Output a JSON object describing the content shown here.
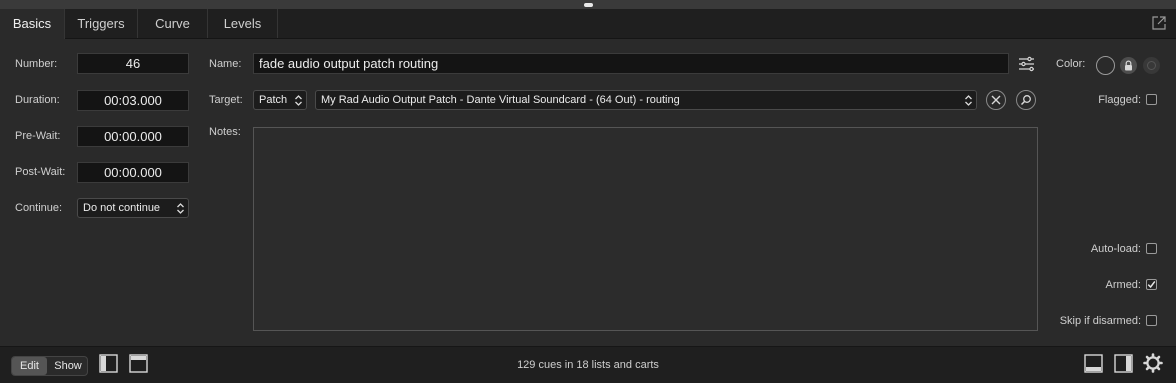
{
  "tabs": [
    {
      "label": "Basics",
      "active": true
    },
    {
      "label": "Triggers",
      "active": false
    },
    {
      "label": "Curve",
      "active": false
    },
    {
      "label": "Levels",
      "active": false
    }
  ],
  "basics": {
    "number_label": "Number:",
    "number_value": "46",
    "duration_label": "Duration:",
    "duration_value": "00:03.000",
    "prewait_label": "Pre-Wait:",
    "prewait_value": "00:00.000",
    "postwait_label": "Post-Wait:",
    "postwait_value": "00:00.000",
    "continue_label": "Continue:",
    "continue_value": "Do not continue",
    "name_label": "Name:",
    "name_value": "fade audio output patch routing",
    "target_label": "Target:",
    "target_type_value": "Patch",
    "target_value": "My Rad Audio Output Patch - Dante Virtual Soundcard - (64 Out) - routing",
    "notes_label": "Notes:",
    "notes_value": "",
    "color_label": "Color:",
    "flagged_label": "Flagged:",
    "flagged": false,
    "autoload_label": "Auto-load:",
    "autoload": false,
    "armed_label": "Armed:",
    "armed": true,
    "skip_label": "Skip if disarmed:",
    "skip": false
  },
  "bottom": {
    "edit_label": "Edit",
    "show_label": "Show",
    "mode": "Edit",
    "status_text": "129 cues in 18 lists and carts"
  },
  "icons": [
    "popout-icon",
    "name-options-icon",
    "clear-target-icon",
    "find-target-icon",
    "lock-icon",
    "toggle-left-sidebar-icon",
    "toggle-top-panel-icon",
    "toggle-bottom-panel-icon",
    "toggle-right-sidebar-icon",
    "settings-gear-icon"
  ],
  "colors": {
    "background": "#2a2a2a",
    "field": "#141414",
    "tabbar": "#1f1f1f",
    "checkmark": "#e6e6e6"
  }
}
